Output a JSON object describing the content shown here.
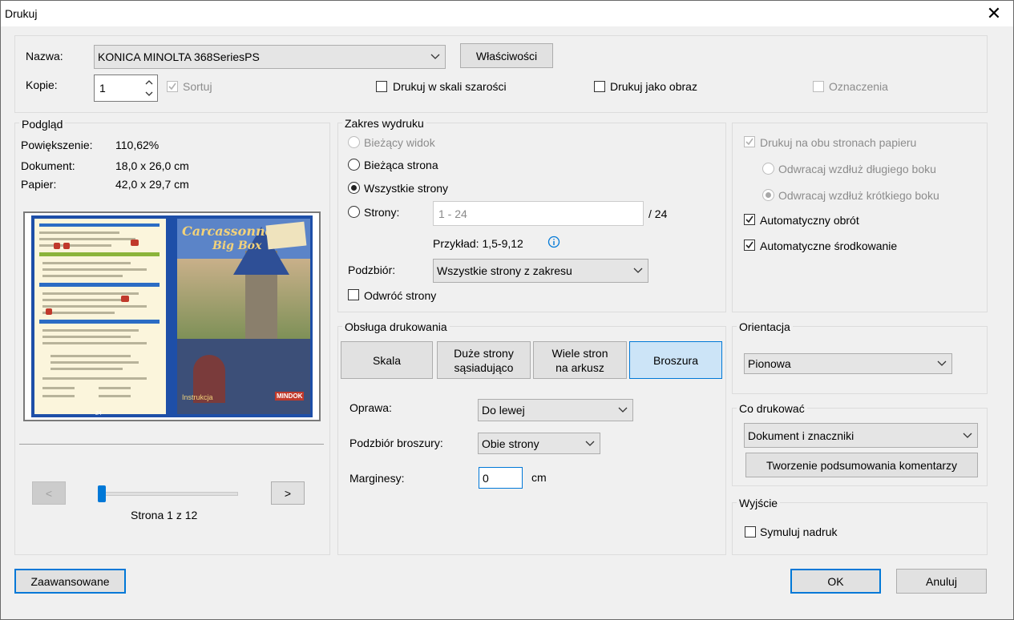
{
  "window": {
    "title": "Drukuj",
    "close_glyph": "✕"
  },
  "printer": {
    "name_label": "Nazwa:",
    "name_value": "KONICA MINOLTA 368SeriesPS",
    "properties_button": "Właściwości",
    "copies_label": "Kopie:",
    "copies_value": "1",
    "collate_label": "Sortuj",
    "grayscale_label": "Drukuj w skali szarości",
    "as_image_label": "Drukuj jako obraz",
    "annotations_label": "Oznaczenia"
  },
  "preview": {
    "legend": "Podgląd",
    "zoom_label": "Powiększenie:",
    "zoom_value": "110,62%",
    "document_label": "Dokument:",
    "document_value": "18,0 x 26,0 cm",
    "paper_label": "Papier:",
    "paper_value": "42,0 x 29,7 cm",
    "prev_glyph": "<",
    "next_glyph": ">",
    "page_status": "Strona 1 z 12",
    "page_slider_fraction": 0.0,
    "thumb_cover_title_1": "Carcassonne",
    "thumb_cover_title_2": "Big Box",
    "thumb_cover_footer": "Instrukcja",
    "thumb_cover_brand": "MINDOK",
    "thumb_page_number": "24"
  },
  "range": {
    "legend": "Zakres wydruku",
    "current_view": "Bieżący widok",
    "current_page": "Bieżąca strona",
    "all_pages": "Wszystkie strony",
    "pages": "Strony:",
    "pages_placeholder": "1 - 24",
    "pages_total": "/ 24",
    "example": "Przykład: 1,5-9,12",
    "subset_label": "Podzbiór:",
    "subset_value": "Wszystkie strony z zakresu",
    "reverse_label": "Odwróć strony"
  },
  "duplex": {
    "both_sides": "Drukuj na obu stronach papieru",
    "flip_long": "Odwracaj wzdłuż długiego boku",
    "flip_short": "Odwracaj wzdłuż krótkiego boku",
    "auto_rotate": "Automatyczny obrót",
    "auto_center": "Automatyczne środkowanie"
  },
  "handling": {
    "legend": "Obsługa drukowania",
    "scale_btn": "Skala",
    "poster_btn_1": "Duże strony",
    "poster_btn_2": "sąsiadująco",
    "multiple_btn_1": "Wiele stron",
    "multiple_btn_2": "na arkusz",
    "booklet_btn": "Broszura",
    "binding_label": "Oprawa:",
    "binding_value": "Do lewej",
    "booklet_subset_label": "Podzbiór broszury:",
    "booklet_subset_value": "Obie strony",
    "margins_label": "Marginesy:",
    "margins_value": "0",
    "margins_unit": "cm"
  },
  "orientation": {
    "legend": "Orientacja",
    "value": "Pionowa"
  },
  "what_to_print": {
    "legend": "Co drukować",
    "value": "Dokument i znaczniki",
    "summarize_btn": "Tworzenie podsumowania komentarzy"
  },
  "output": {
    "legend": "Wyjście",
    "simulate_label": "Symuluj nadruk"
  },
  "footer": {
    "advanced_btn": "Zaawansowane",
    "ok_btn": "OK",
    "cancel_btn": "Anuluj"
  },
  "colors": {
    "accent": "#0078d7",
    "active_button": "#cce4f7",
    "panel_border": "#dcdcdc"
  }
}
